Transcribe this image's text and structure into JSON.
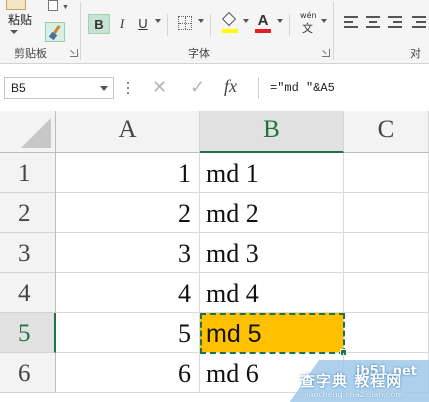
{
  "ribbon": {
    "paste_label": "粘贴",
    "clipboard_group_label": "剪贴板",
    "font_group_label": "字体",
    "bold_label": "B",
    "italic_label": "I",
    "underline_label": "U",
    "font_color_label": "A",
    "phonetic_top": "wén",
    "phonetic_main": "文",
    "truncated_group_label": "对",
    "fill_color": "#ffff00",
    "font_color": "#e51c23"
  },
  "formula_bar": {
    "name_box": "B5",
    "cancel_glyph": "✕",
    "enter_glyph": "✓",
    "fx_label": "fx",
    "formula": "=\"md \"&A5"
  },
  "sheet": {
    "columns": [
      "A",
      "B",
      "C"
    ],
    "selected_column": "B",
    "selected_row": "5",
    "selection_color": "#217346",
    "active_cell_fill": "#ffc000",
    "rows": [
      {
        "row": "1",
        "a": "1",
        "b": "md 1"
      },
      {
        "row": "2",
        "a": "2",
        "b": "md 2"
      },
      {
        "row": "3",
        "a": "3",
        "b": "md 3"
      },
      {
        "row": "4",
        "a": "4",
        "b": "md 4"
      },
      {
        "row": "5",
        "a": "5",
        "b": "md 5"
      },
      {
        "row": "6",
        "a": "6",
        "b": "md 6"
      }
    ]
  },
  "watermark": {
    "site": "jb51.net",
    "text": "查字典 教程网",
    "url": "jiaocheng.chazidian.com"
  }
}
